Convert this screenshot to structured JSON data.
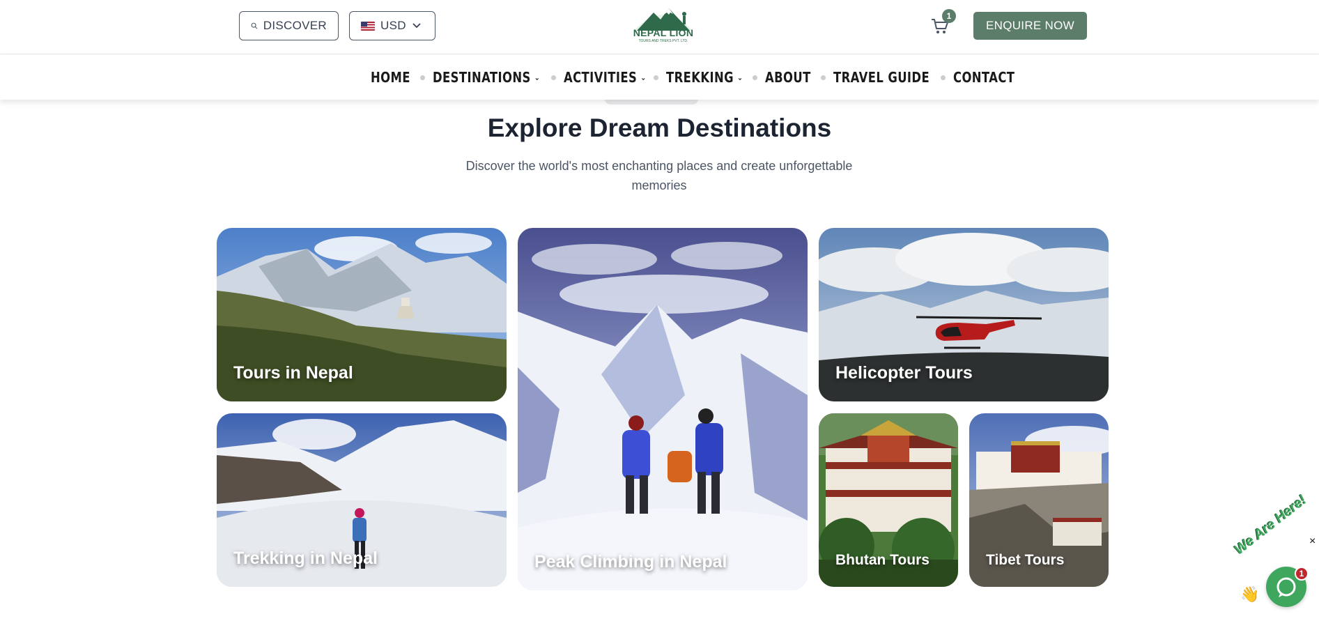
{
  "header": {
    "discover_label": "DISCOVER",
    "currency_label": "USD",
    "logo_text": "NEPAL LION",
    "logo_subtext": "TOURS AND TREKS PVT. LTD.",
    "cart_count": "1",
    "enquire_label": "ENQUIRE NOW"
  },
  "nav": {
    "items": [
      {
        "label": "HOME",
        "dropdown": false
      },
      {
        "label": "DESTINATIONS",
        "dropdown": true
      },
      {
        "label": "ACTIVITIES",
        "dropdown": true
      },
      {
        "label": "TREKKING",
        "dropdown": true
      },
      {
        "label": "ABOUT",
        "dropdown": false
      },
      {
        "label": "TRAVEL GUIDE",
        "dropdown": false
      },
      {
        "label": "CONTACT",
        "dropdown": false
      }
    ]
  },
  "section": {
    "title": "Explore Dream Destinations",
    "subtitle": "Discover the world's most enchanting places and create unforgettable memories"
  },
  "cards": [
    {
      "label": "Tours in Nepal"
    },
    {
      "label": "Peak Climbing in Nepal"
    },
    {
      "label": "Helicopter Tours"
    },
    {
      "label": "Trekking in Nepal"
    },
    {
      "label": "Bhutan Tours"
    },
    {
      "label": "Tibet Tours"
    }
  ],
  "chat": {
    "banner_text": "We Are Here!",
    "unread_count": "1",
    "close_glyph": "×"
  },
  "colors": {
    "brand_green": "#5b7d6a",
    "chat_green": "#3fa75d",
    "badge_red": "#c0262d",
    "heading": "#1c2331"
  },
  "icons": [
    "search-icon",
    "us-flag-icon",
    "chevron-down-icon",
    "cart-icon",
    "chat-icon",
    "close-icon",
    "waving-hand-icon"
  ]
}
